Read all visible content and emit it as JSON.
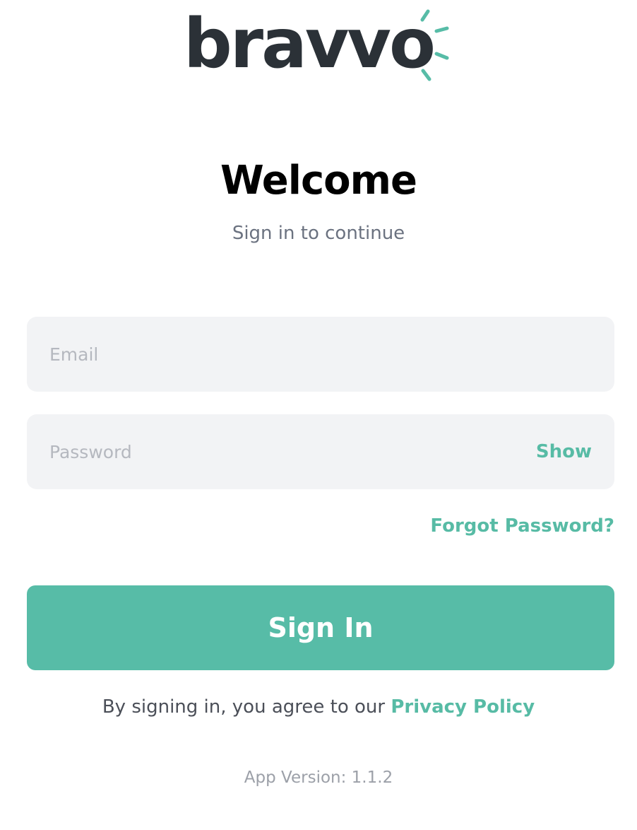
{
  "brand": {
    "name": "bravvo",
    "word_color": "#2b3137",
    "accent_color": "#57bca7"
  },
  "header": {
    "title": "Welcome",
    "subtitle": "Sign in to continue"
  },
  "form": {
    "email_placeholder": "Email",
    "email_value": "",
    "password_placeholder": "Password",
    "password_value": "",
    "show_label": "Show",
    "forgot_label": "Forgot Password?",
    "submit_label": "Sign In"
  },
  "footer": {
    "terms_prefix": "By signing in, you agree to our ",
    "privacy_link": "Privacy Policy",
    "version_text": "App Version: 1.1.2"
  },
  "icons": {
    "logo_rays": "sparkle-rays-icon"
  }
}
